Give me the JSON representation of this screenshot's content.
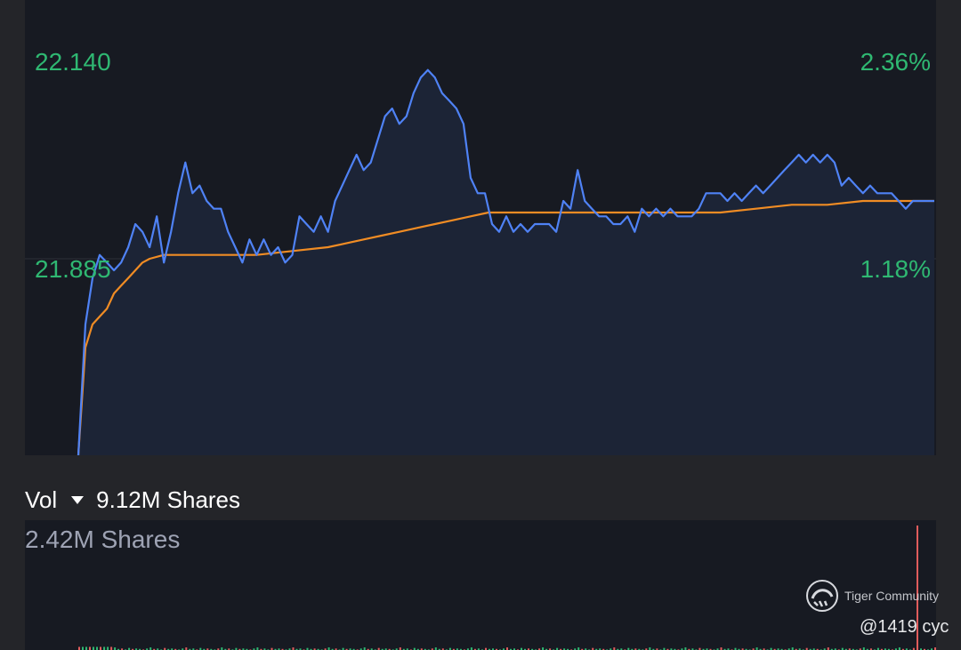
{
  "price_axis": {
    "left_top": "22.140",
    "left_mid": "21.885",
    "right_top": "2.36%",
    "right_mid": "1.18%"
  },
  "volume": {
    "label": "Vol",
    "total": "9.12M Shares",
    "max_label": "2.42M Shares"
  },
  "watermark": {
    "brand": "Tiger Community",
    "handle": "@1419 cyc"
  },
  "colors": {
    "price_line": "#4f82f5",
    "avg_line": "#f08c24",
    "up": "#2fb872",
    "down": "#e05c5c",
    "panel_bg": "#171a22",
    "page_bg": "#242529"
  },
  "chart_data": [
    {
      "type": "line",
      "ylim": [
        21.63,
        22.14
      ],
      "reference_price": 21.885,
      "right_axis_ticks": [
        "2.36%",
        "1.18%"
      ],
      "x_count": 241,
      "series": [
        {
          "values": [
            [
              0,
              21.63
            ],
            [
              2,
              21.8
            ],
            [
              4,
              21.86
            ],
            [
              6,
              21.89
            ],
            [
              8,
              21.88
            ],
            [
              10,
              21.87
            ],
            [
              12,
              21.88
            ],
            [
              14,
              21.9
            ],
            [
              16,
              21.93
            ],
            [
              18,
              21.92
            ],
            [
              20,
              21.9
            ],
            [
              22,
              21.94
            ],
            [
              24,
              21.88
            ],
            [
              26,
              21.92
            ],
            [
              28,
              21.97
            ],
            [
              30,
              22.01
            ],
            [
              32,
              21.97
            ],
            [
              34,
              21.98
            ],
            [
              36,
              21.96
            ],
            [
              38,
              21.95
            ],
            [
              40,
              21.95
            ],
            [
              42,
              21.92
            ],
            [
              44,
              21.9
            ],
            [
              46,
              21.88
            ],
            [
              48,
              21.91
            ],
            [
              50,
              21.89
            ],
            [
              52,
              21.91
            ],
            [
              54,
              21.89
            ],
            [
              56,
              21.9
            ],
            [
              58,
              21.88
            ],
            [
              60,
              21.89
            ],
            [
              62,
              21.94
            ],
            [
              64,
              21.93
            ],
            [
              66,
              21.92
            ],
            [
              68,
              21.94
            ],
            [
              70,
              21.92
            ],
            [
              72,
              21.96
            ],
            [
              74,
              21.98
            ],
            [
              76,
              22.0
            ],
            [
              78,
              22.02
            ],
            [
              80,
              22.0
            ],
            [
              82,
              22.01
            ],
            [
              84,
              22.04
            ],
            [
              86,
              22.07
            ],
            [
              88,
              22.08
            ],
            [
              90,
              22.06
            ],
            [
              92,
              22.07
            ],
            [
              94,
              22.1
            ],
            [
              96,
              22.12
            ],
            [
              98,
              22.13
            ],
            [
              100,
              22.12
            ],
            [
              102,
              22.1
            ],
            [
              104,
              22.09
            ],
            [
              106,
              22.08
            ],
            [
              108,
              22.06
            ],
            [
              110,
              21.99
            ],
            [
              112,
              21.97
            ],
            [
              114,
              21.97
            ],
            [
              116,
              21.93
            ],
            [
              118,
              21.92
            ],
            [
              120,
              21.94
            ],
            [
              122,
              21.92
            ],
            [
              124,
              21.93
            ],
            [
              126,
              21.92
            ],
            [
              128,
              21.93
            ],
            [
              130,
              21.93
            ],
            [
              132,
              21.93
            ],
            [
              134,
              21.92
            ],
            [
              136,
              21.96
            ],
            [
              138,
              21.95
            ],
            [
              140,
              22.0
            ],
            [
              142,
              21.96
            ],
            [
              144,
              21.95
            ],
            [
              146,
              21.94
            ],
            [
              148,
              21.94
            ],
            [
              150,
              21.93
            ],
            [
              152,
              21.93
            ],
            [
              154,
              21.94
            ],
            [
              156,
              21.92
            ],
            [
              158,
              21.95
            ],
            [
              160,
              21.94
            ],
            [
              162,
              21.95
            ],
            [
              164,
              21.94
            ],
            [
              166,
              21.95
            ],
            [
              168,
              21.94
            ],
            [
              170,
              21.94
            ],
            [
              172,
              21.94
            ],
            [
              174,
              21.95
            ],
            [
              176,
              21.97
            ],
            [
              178,
              21.97
            ],
            [
              180,
              21.97
            ],
            [
              182,
              21.96
            ],
            [
              184,
              21.97
            ],
            [
              186,
              21.96
            ],
            [
              188,
              21.97
            ],
            [
              190,
              21.98
            ],
            [
              192,
              21.97
            ],
            [
              194,
              21.98
            ],
            [
              196,
              21.99
            ],
            [
              198,
              22.0
            ],
            [
              200,
              22.01
            ],
            [
              202,
              22.02
            ],
            [
              204,
              22.01
            ],
            [
              206,
              22.02
            ],
            [
              208,
              22.01
            ],
            [
              210,
              22.02
            ],
            [
              212,
              22.01
            ],
            [
              214,
              21.98
            ],
            [
              216,
              21.99
            ],
            [
              218,
              21.98
            ],
            [
              220,
              21.97
            ],
            [
              222,
              21.98
            ],
            [
              224,
              21.97
            ],
            [
              226,
              21.97
            ],
            [
              228,
              21.97
            ],
            [
              230,
              21.96
            ],
            [
              232,
              21.95
            ],
            [
              234,
              21.96
            ],
            [
              236,
              21.96
            ],
            [
              238,
              21.96
            ],
            [
              240,
              21.96
            ]
          ]
        },
        {
          "values": [
            [
              0,
              21.63
            ],
            [
              2,
              21.77
            ],
            [
              4,
              21.8
            ],
            [
              6,
              21.81
            ],
            [
              8,
              21.82
            ],
            [
              10,
              21.84
            ],
            [
              12,
              21.85
            ],
            [
              14,
              21.86
            ],
            [
              16,
              21.87
            ],
            [
              18,
              21.88
            ],
            [
              20,
              21.885
            ],
            [
              24,
              21.89
            ],
            [
              30,
              21.89
            ],
            [
              40,
              21.89
            ],
            [
              50,
              21.89
            ],
            [
              60,
              21.895
            ],
            [
              70,
              21.9
            ],
            [
              75,
              21.905
            ],
            [
              80,
              21.91
            ],
            [
              85,
              21.915
            ],
            [
              90,
              21.92
            ],
            [
              95,
              21.925
            ],
            [
              100,
              21.93
            ],
            [
              105,
              21.935
            ],
            [
              110,
              21.94
            ],
            [
              115,
              21.945
            ],
            [
              120,
              21.945
            ],
            [
              130,
              21.945
            ],
            [
              140,
              21.945
            ],
            [
              150,
              21.945
            ],
            [
              160,
              21.945
            ],
            [
              170,
              21.945
            ],
            [
              180,
              21.945
            ],
            [
              190,
              21.95
            ],
            [
              200,
              21.955
            ],
            [
              210,
              21.955
            ],
            [
              220,
              21.96
            ],
            [
              230,
              21.96
            ],
            [
              240,
              21.96
            ]
          ]
        }
      ]
    },
    {
      "type": "bar",
      "ylabel": "2.42M Shares",
      "ylim": [
        0,
        2.42
      ],
      "x_count": 241,
      "note_max": 2.42,
      "spike": [
        235,
        2.42,
        "down"
      ],
      "values_pattern": [
        0.05,
        0.02,
        0.03,
        0.01,
        0.04,
        0.02,
        0.03,
        0.02,
        0.01,
        0.03
      ]
    }
  ]
}
